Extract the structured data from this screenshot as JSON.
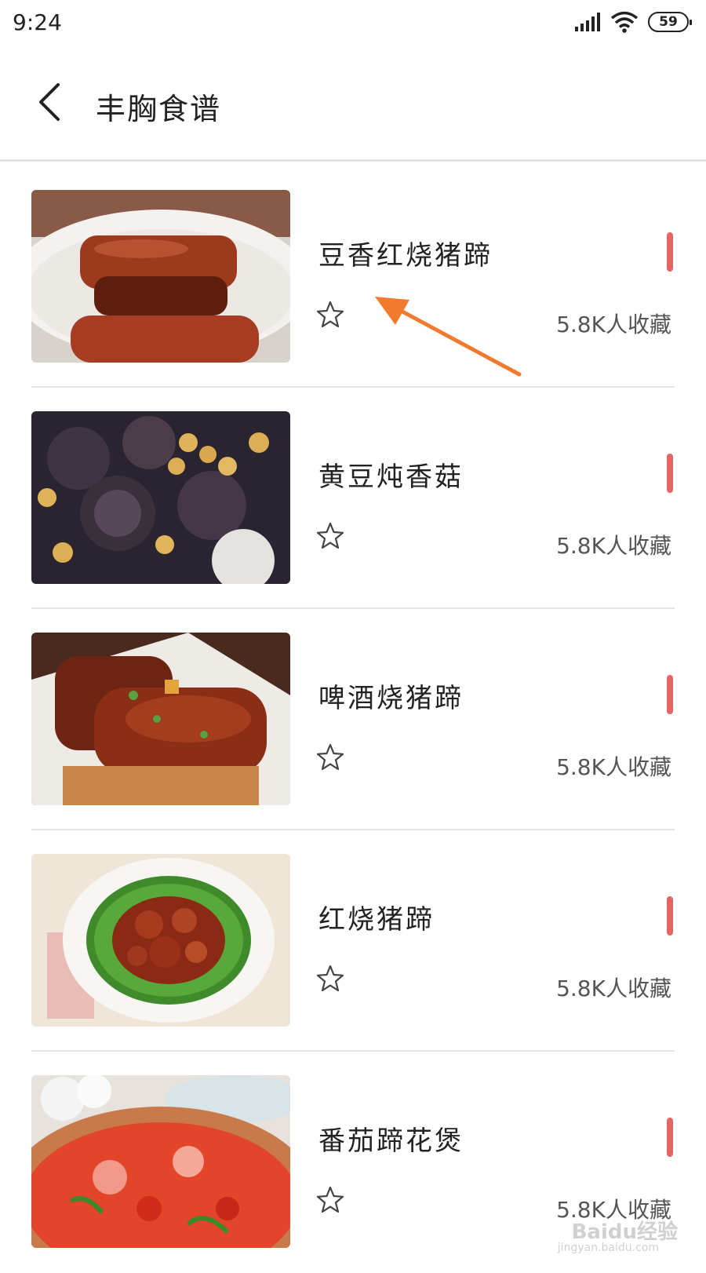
{
  "status_bar": {
    "time": "9:24",
    "battery": "59",
    "icons": [
      "signal-icon",
      "wifi-icon",
      "battery-icon"
    ]
  },
  "header": {
    "title": "丰胸食谱",
    "back_icon": "chevron-left-icon"
  },
  "recipes": [
    {
      "title": "豆香红烧猪蹄",
      "favorites": "5.8K人收藏"
    },
    {
      "title": "黄豆炖香菇",
      "favorites": "5.8K人收藏"
    },
    {
      "title": "啤酒烧猪蹄",
      "favorites": "5.8K人收藏"
    },
    {
      "title": "红烧猪蹄",
      "favorites": "5.8K人收藏"
    },
    {
      "title": "番茄蹄花煲",
      "favorites": "5.8K人收藏"
    }
  ],
  "watermark": {
    "brand": "Baidu经验",
    "url": "jingyan.baidu.com"
  },
  "colors": {
    "accent": "#e56565",
    "arrow": "#f07a2e",
    "divider": "#e6e6e6"
  }
}
